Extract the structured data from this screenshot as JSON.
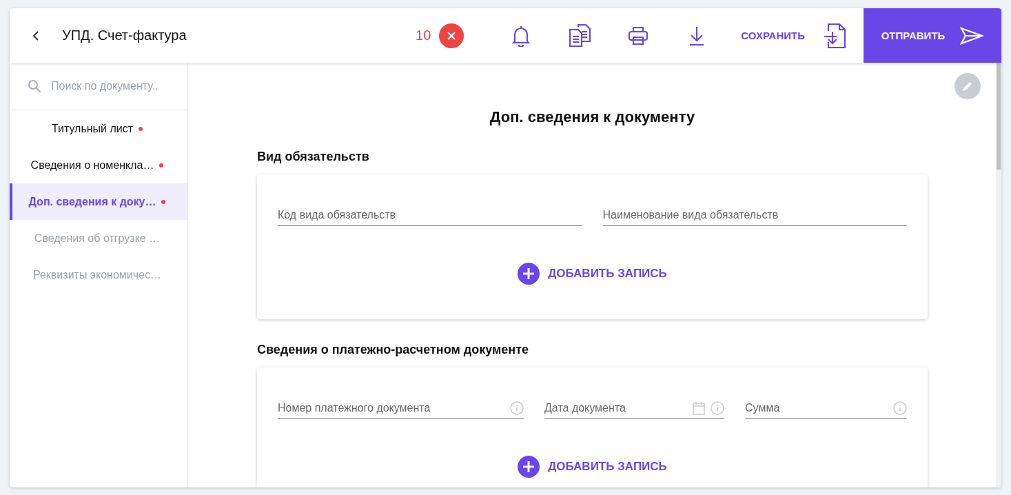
{
  "header": {
    "title": "УПД. Счет-фактура",
    "error_count": "10",
    "save_label": "СОХРАНИТЬ",
    "send_label": "ОТПРАВИТЬ"
  },
  "sidebar": {
    "search_placeholder": "Поиск по документу..",
    "items": [
      {
        "label": "Титульный лист",
        "selected": false,
        "disabled": false,
        "has_error": true
      },
      {
        "label": "Сведения о номенкла…",
        "selected": false,
        "disabled": false,
        "has_error": true
      },
      {
        "label": "Доп. сведения к доку…",
        "selected": true,
        "disabled": false,
        "has_error": true
      },
      {
        "label": "Сведения об отгрузке …",
        "selected": false,
        "disabled": true,
        "has_error": false
      },
      {
        "label": "Реквизиты экономичес…",
        "selected": false,
        "disabled": true,
        "has_error": false
      }
    ]
  },
  "content": {
    "title": "Доп. сведения к документу",
    "sections": [
      {
        "title": "Вид обязательств",
        "add_label": "ДОБАВИТЬ ЗАПИСЬ",
        "fields": [
          {
            "placeholder": "Код вида обязательств",
            "wide": true,
            "has_calendar": false,
            "has_info": false
          },
          {
            "placeholder": "Наименование вида обязательств",
            "wide": true,
            "has_calendar": false,
            "has_info": false
          }
        ]
      },
      {
        "title": "Сведения о платежно-расчетном документе",
        "add_label": "ДОБАВИТЬ ЗАПИСЬ",
        "fields": [
          {
            "placeholder": "Номер платежного документа",
            "wide": true,
            "has_calendar": false,
            "has_info": true
          },
          {
            "placeholder": "Дата документа",
            "wide": false,
            "has_calendar": true,
            "has_info": true
          },
          {
            "placeholder": "Сумма",
            "wide": false,
            "has_calendar": false,
            "has_info": true
          }
        ]
      }
    ]
  }
}
